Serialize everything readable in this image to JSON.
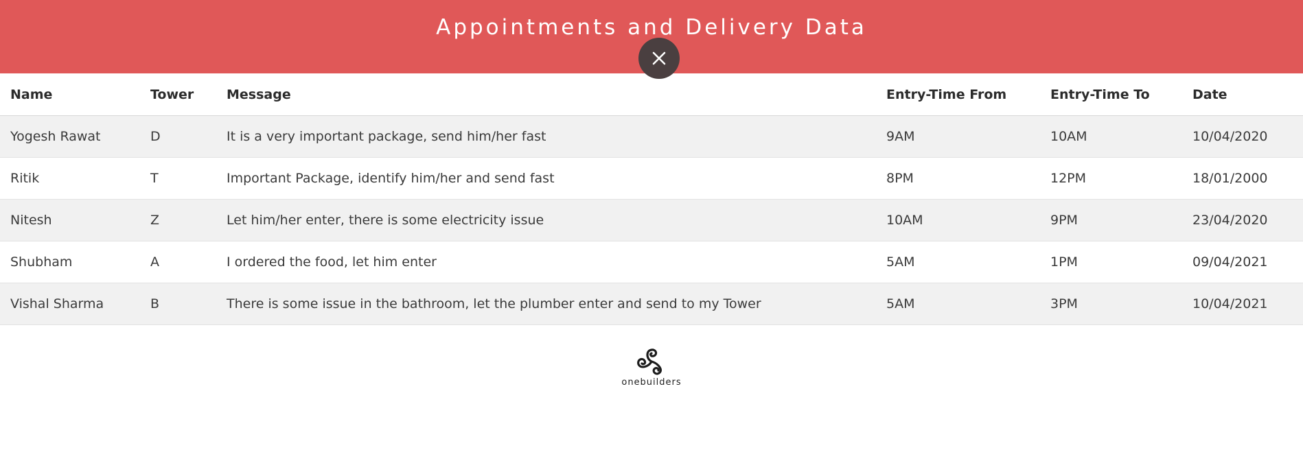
{
  "header": {
    "title": "Appointments and Delivery Data",
    "close_icon": "close-icon",
    "background_color": "#e05858"
  },
  "table": {
    "columns": [
      "Name",
      "Tower",
      "Message",
      "Entry-Time From",
      "Entry-Time To",
      "Date"
    ],
    "rows": [
      [
        "Yogesh Rawat",
        "D",
        "It is a very important package, send him/her fast",
        "9AM",
        "10AM",
        "10/04/2020"
      ],
      [
        "Ritik",
        "T",
        "Important Package, identify him/her and send fast",
        "8PM",
        "12PM",
        "18/01/2000"
      ],
      [
        "Nitesh",
        "Z",
        "Let him/her enter, there is some electricity issue",
        "10AM",
        "9PM",
        "23/04/2020"
      ],
      [
        "Shubham",
        "A",
        "I ordered the food, let him enter",
        "5AM",
        "1PM",
        "09/04/2021"
      ],
      [
        "Vishal Sharma",
        "B",
        "There is some issue in the bathroom, let the plumber enter and send to my Tower",
        "5AM",
        "3PM",
        "10/04/2021"
      ]
    ]
  },
  "footer": {
    "logo_text": "onebuilders",
    "logo_icon": "triskelion-logo-icon"
  }
}
